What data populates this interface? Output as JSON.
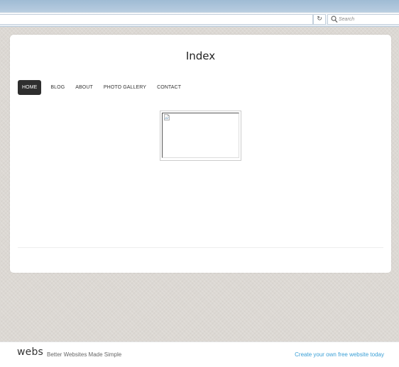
{
  "browser": {
    "search_placeholder": "Search",
    "refresh_icon": "refresh-icon",
    "search_icon": "search-icon"
  },
  "page": {
    "title": "Index",
    "nav": [
      {
        "label": "HOME",
        "active": true
      },
      {
        "label": "BLOG",
        "active": false
      },
      {
        "label": "ABOUT",
        "active": false
      },
      {
        "label": "PHOTO GALLERY",
        "active": false
      },
      {
        "label": "CONTACT",
        "active": false
      }
    ],
    "image_icon": "broken-image-icon"
  },
  "footer": {
    "logo": "webs",
    "tagline": "Better Websites Made Simple",
    "cta_link": "Create your own free website today"
  },
  "colors": {
    "nav_active_bg": "#2e2e2e",
    "link": "#3a9fd6",
    "background": "#dcd8d3"
  }
}
